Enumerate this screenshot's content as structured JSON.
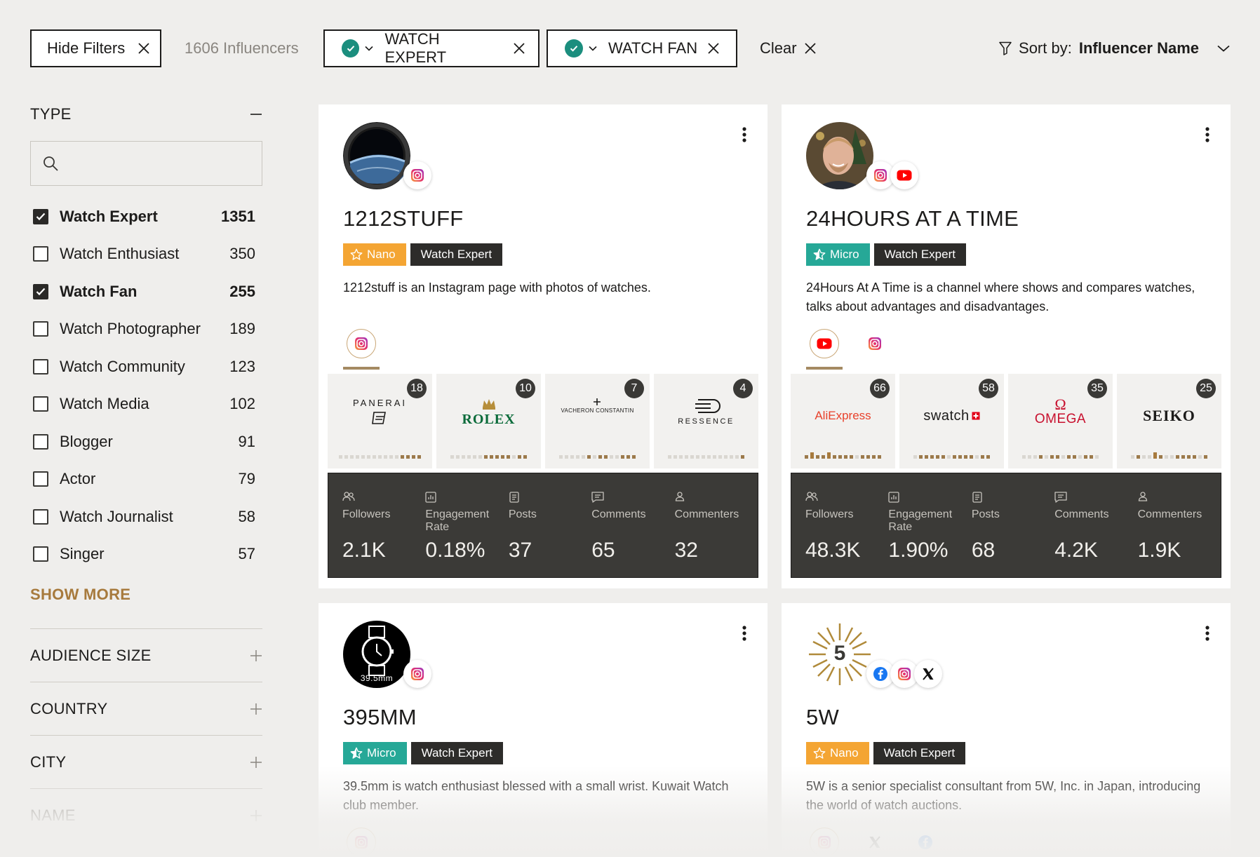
{
  "topbar": {
    "hide_filters": "Hide Filters",
    "influencer_count": "1606 Influencers",
    "chips": [
      "WATCH EXPERT",
      "WATCH FAN"
    ],
    "clear": "Clear",
    "sort_label": "Sort by:",
    "sort_value": "Influencer Name"
  },
  "sidebar": {
    "type_title": "TYPE",
    "search_placeholder": "",
    "types": [
      {
        "label": "Watch Expert",
        "count": "1351",
        "checked": true
      },
      {
        "label": "Watch Enthusiast",
        "count": "350",
        "checked": false
      },
      {
        "label": "Watch Fan",
        "count": "255",
        "checked": true
      },
      {
        "label": "Watch Photographer",
        "count": "189",
        "checked": false
      },
      {
        "label": "Watch Community",
        "count": "123",
        "checked": false
      },
      {
        "label": "Watch Media",
        "count": "102",
        "checked": false
      },
      {
        "label": "Blogger",
        "count": "91",
        "checked": false
      },
      {
        "label": "Actor",
        "count": "79",
        "checked": false
      },
      {
        "label": "Watch Journalist",
        "count": "58",
        "checked": false
      },
      {
        "label": "Singer",
        "count": "57",
        "checked": false
      }
    ],
    "show_more": "SHOW MORE",
    "sections": [
      "AUDIENCE SIZE",
      "COUNTRY",
      "CITY",
      "NAME"
    ]
  },
  "stat_labels": {
    "followers": "Followers",
    "engagement": "Engagement Rate",
    "posts": "Posts",
    "comments": "Comments",
    "commenters": "Commenters"
  },
  "cards": [
    {
      "name": "1212STUFF",
      "tier": "Nano",
      "type": "Watch Expert",
      "description": "1212stuff is an Instagram page with photos of watches.",
      "socials": [
        "instagram-icon"
      ],
      "brands": [
        {
          "name": "PANERAI",
          "count": "18"
        },
        {
          "name": "ROLEX",
          "count": "10"
        },
        {
          "name": "VACHERON CONSTANTIN",
          "count": "7"
        },
        {
          "name": "RESSENCE",
          "count": "4"
        }
      ],
      "stats": {
        "followers": "2.1K",
        "engagement": "0.18%",
        "posts": "37",
        "comments": "65",
        "commenters": "32"
      }
    },
    {
      "name": "24HOURS AT A TIME",
      "tier": "Micro",
      "type": "Watch Expert",
      "description": "24Hours At A Time is a channel where shows and compares watches, talks about advantages and disadvantages.",
      "socials": [
        "instagram-icon",
        "youtube-icon"
      ],
      "brands": [
        {
          "name": "AliExpress",
          "count": "66"
        },
        {
          "name": "swatch",
          "count": "58"
        },
        {
          "name": "OMEGA",
          "count": "35"
        },
        {
          "name": "SEIKO",
          "count": "25"
        }
      ],
      "stats": {
        "followers": "48.3K",
        "engagement": "1.90%",
        "posts": "68",
        "comments": "4.2K",
        "commenters": "1.9K"
      }
    },
    {
      "name": "395MM",
      "tier": "Micro",
      "type": "Watch Expert",
      "avatar_text": "39.5mm",
      "description": "39.5mm is watch enthusiast blessed with a small wrist. Kuwait Watch club member.",
      "socials": [
        "instagram-icon"
      ]
    },
    {
      "name": "5W",
      "tier": "Nano",
      "type": "Watch Expert",
      "avatar_text": "5",
      "description": "5W is a senior specialist consultant from 5W, Inc. in Japan, introducing the world of watch auctions.",
      "socials": [
        "facebook-icon",
        "instagram-icon",
        "x-icon"
      ]
    }
  ],
  "colors": {
    "accent": "#a77a3d",
    "teal": "#1b8e7e",
    "nano": "#f4a533",
    "micro": "#26a897",
    "dark": "#3b3a37"
  }
}
